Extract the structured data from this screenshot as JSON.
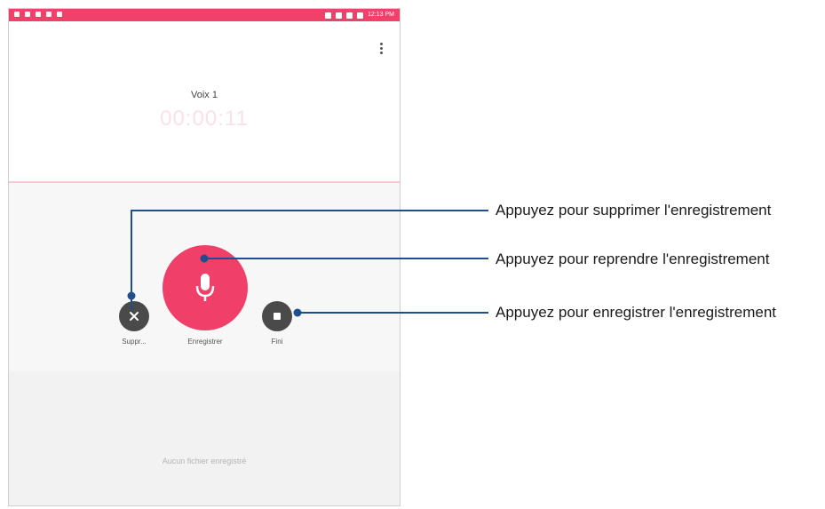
{
  "status_bar": {
    "time": "12:13 PM",
    "color": "#f0416b"
  },
  "recording": {
    "title": "Voix 1",
    "timer": "00:00:11"
  },
  "controls": {
    "delete_label": "Suppr...",
    "record_label": "Enregistrer",
    "finish_label": "Fini",
    "record_color": "#f0406a",
    "icons": [
      "close-icon",
      "microphone-icon",
      "stop-icon",
      "more-vert-icon"
    ]
  },
  "empty_state": "Aucun fichier enregistré",
  "callouts": [
    "Appuyez pour supprimer l'enregistrement",
    "Appuyez pour reprendre l'enregistrement",
    "Appuyez pour enregistrer l'enregistrement"
  ],
  "callout_line_color": "#1f4e8c"
}
